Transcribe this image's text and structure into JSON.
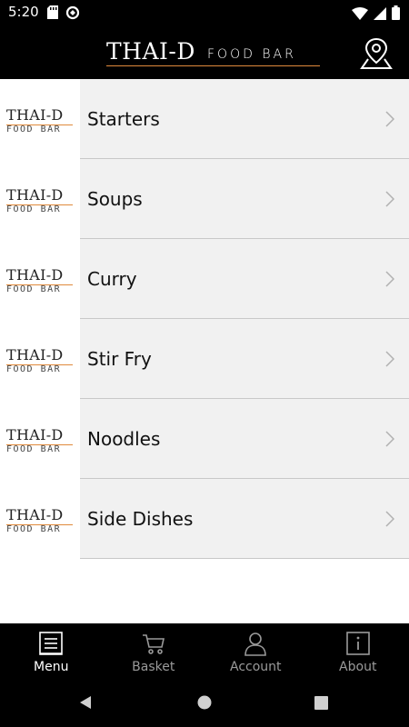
{
  "status_bar": {
    "time": "5:20",
    "left_icons": [
      "sd-card-icon",
      "data-saver-icon"
    ],
    "right_icons": [
      "wifi-icon",
      "signal-icon",
      "battery-icon"
    ]
  },
  "header": {
    "logo_main": "THAI-D",
    "logo_sub": "FOOD BAR",
    "location_icon": "location-pin-icon",
    "accent_color": "#e08a3c"
  },
  "menu": {
    "thumb_main": "THAI-D",
    "thumb_sub": "FOOD BAR",
    "items": [
      {
        "label": "Starters"
      },
      {
        "label": "Soups"
      },
      {
        "label": "Curry"
      },
      {
        "label": "Stir Fry"
      },
      {
        "label": "Noodles"
      },
      {
        "label": "Side Dishes"
      }
    ]
  },
  "bottom_nav": {
    "tabs": [
      {
        "label": "Menu",
        "icon": "menu-list-icon",
        "active": true
      },
      {
        "label": "Basket",
        "icon": "basket-icon",
        "active": false
      },
      {
        "label": "Account",
        "icon": "account-icon",
        "active": false
      },
      {
        "label": "About",
        "icon": "info-icon",
        "active": false
      }
    ]
  },
  "system_nav": {
    "buttons": [
      "back-icon",
      "home-icon",
      "recents-icon"
    ]
  }
}
